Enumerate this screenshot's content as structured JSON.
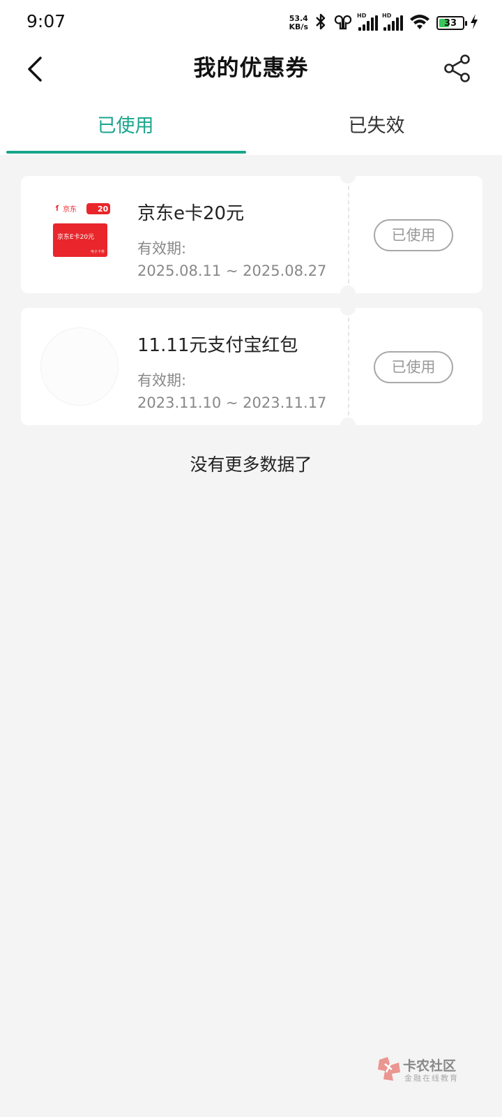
{
  "status_bar": {
    "time": "9:07",
    "net_speed_value": "53.4",
    "net_speed_unit": "KB/s",
    "battery": "33",
    "signal_label_1": "HD",
    "signal_label_2": "HD",
    "icons": [
      "bluetooth-icon",
      "earbuds-icon",
      "signal-icon",
      "signal-icon",
      "wifi-icon",
      "battery-icon",
      "charging-icon"
    ]
  },
  "header": {
    "title": "我的优惠券",
    "back_icon": "chevron-left-icon",
    "share_icon": "share-icon"
  },
  "tabs": [
    {
      "label": "已使用",
      "active": true
    },
    {
      "label": "已失效",
      "active": false
    }
  ],
  "coupons": [
    {
      "title": "京东e卡20元",
      "valid_label": "有效期:",
      "range": "2025.08.11 ~ 2025.08.27",
      "status": "已使用",
      "thumb": {
        "brand": "京东",
        "amount": "20",
        "card_text": "京东E卡20元",
        "sub_text": "电子卡券"
      }
    },
    {
      "title": "11.11元支付宝红包",
      "valid_label": "有效期:",
      "range": "2023.11.10 ~ 2023.11.17",
      "status": "已使用"
    }
  ],
  "footer_text": "没有更多数据了",
  "watermark": {
    "title": "卡农社区",
    "subtitle": "金融在线教育"
  },
  "colors": {
    "accent": "#1aa58c",
    "background": "#f4f4f4",
    "jd_red": "#e8262b"
  }
}
